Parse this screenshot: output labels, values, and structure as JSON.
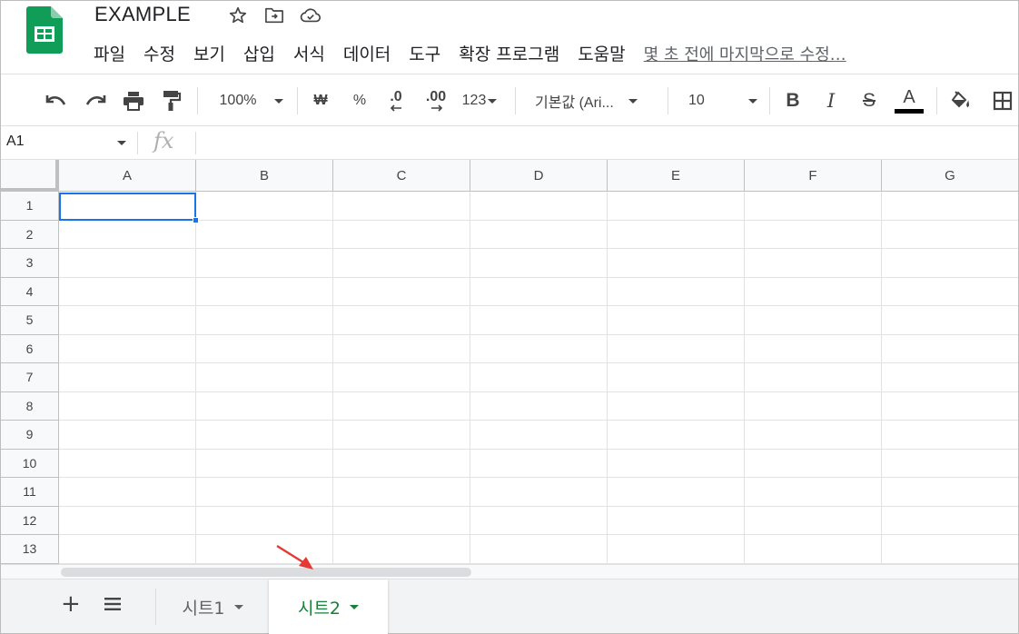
{
  "window": {
    "doc_title": "EXAMPLE",
    "icons": [
      "star-icon",
      "move-to-folder-icon",
      "cloud-saved-icon"
    ]
  },
  "menubar": {
    "items": [
      "파일",
      "수정",
      "보기",
      "삽입",
      "서식",
      "데이터",
      "도구",
      "확장 프로그램",
      "도움말"
    ],
    "last_edit": "몇 초 전에 마지막으로 수정…"
  },
  "toolbar": {
    "zoom": "100%",
    "currency": "₩",
    "percent": "%",
    "decrease_decimal": ".0",
    "increase_decimal": ".00",
    "more_formats": "123",
    "font_family": "기본값 (Ari...",
    "font_size": "10",
    "bold": "B",
    "italic": "I",
    "strikethrough": "S",
    "text_color": "A"
  },
  "formula_bar": {
    "name_box": "A1",
    "fx_label": "fx",
    "value": ""
  },
  "grid": {
    "columns": [
      "A",
      "B",
      "C",
      "D",
      "E",
      "F",
      "G"
    ],
    "rows": [
      "1",
      "2",
      "3",
      "4",
      "5",
      "6",
      "7",
      "8",
      "9",
      "10",
      "11",
      "12",
      "13"
    ],
    "selected_cell": "A1"
  },
  "sheets": {
    "tabs": [
      {
        "label": "시트1",
        "active": false
      },
      {
        "label": "시트2",
        "active": true
      }
    ]
  },
  "colors": {
    "brand_green": "#0f9d58",
    "selection_blue": "#1a73e8",
    "active_tab_green": "#188038",
    "annotation_red": "#e53935"
  }
}
